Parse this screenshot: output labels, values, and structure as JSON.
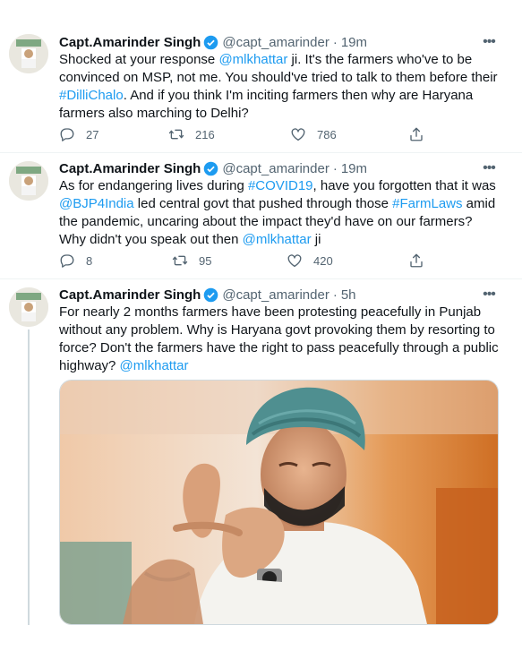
{
  "tweets": [
    {
      "name": "Capt.Amarinder Singh",
      "handle": "@capt_amarinder",
      "time": "19m",
      "text": [
        {
          "t": "Shocked at your response ",
          "link": false
        },
        {
          "t": "@mlkhattar",
          "link": true
        },
        {
          "t": " ji. It's the farmers who've to be convinced on MSP, not me. You should've tried to talk to them before their ",
          "link": false
        },
        {
          "t": "#DilliChalo",
          "link": true
        },
        {
          "t": ". And if you think I'm inciting farmers then why are Haryana farmers also marching to Delhi?",
          "link": false
        }
      ],
      "replies": "27",
      "retweets": "216",
      "likes": "786"
    },
    {
      "name": "Capt.Amarinder Singh",
      "handle": "@capt_amarinder",
      "time": "19m",
      "text": [
        {
          "t": "As for endangering lives during ",
          "link": false
        },
        {
          "t": "#COVID19",
          "link": true
        },
        {
          "t": ", have you forgotten that it was ",
          "link": false
        },
        {
          "t": "@BJP4India",
          "link": true
        },
        {
          "t": " led central govt that pushed through those ",
          "link": false
        },
        {
          "t": "#FarmLaws",
          "link": true
        },
        {
          "t": " amid the pandemic, uncaring about the impact they'd have on our farmers? Why didn't you speak out then ",
          "link": false
        },
        {
          "t": "@mlkhattar",
          "link": true
        },
        {
          "t": " ji",
          "link": false
        }
      ],
      "replies": "8",
      "retweets": "95",
      "likes": "420"
    },
    {
      "name": "Capt.Amarinder Singh",
      "handle": "@capt_amarinder",
      "time": "5h",
      "text": [
        {
          "t": "For nearly 2 months farmers have been protesting peacefully in Punjab without any problem. Why is Haryana govt provoking them by resorting to force? Don't the farmers have the right to pass peacefully through a public highway? ",
          "link": false
        },
        {
          "t": "@mlkhattar",
          "link": true
        }
      ]
    }
  ],
  "dot_separator": "·",
  "more_label": "•••",
  "colors": {
    "link": "#1d9bf0",
    "verified": "#1d9bf0",
    "secondary_text": "#536471",
    "turban": "#4f8f90",
    "background_orange": "#d9782a"
  },
  "icons": [
    "avatar",
    "verified-badge-icon",
    "more-options-icon",
    "reply-icon",
    "retweet-icon",
    "like-icon",
    "share-icon"
  ]
}
